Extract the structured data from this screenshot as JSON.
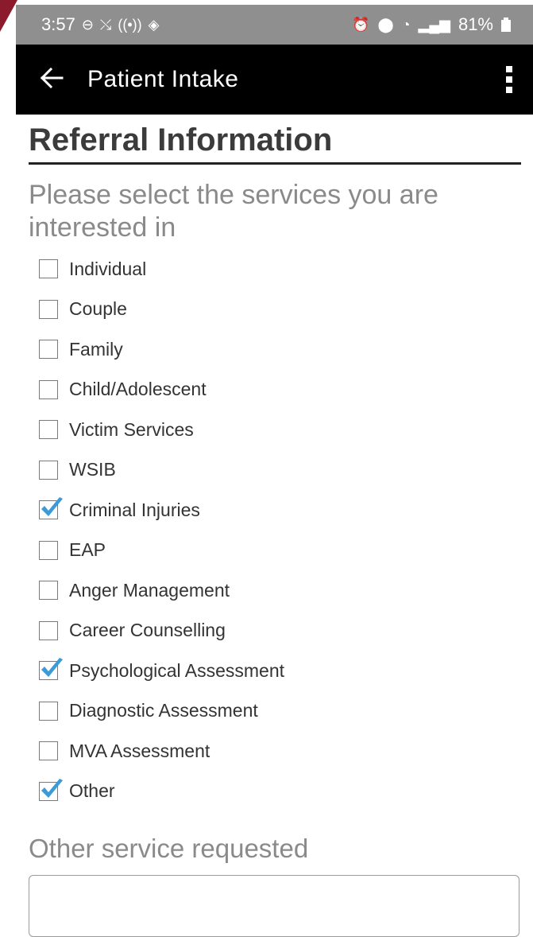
{
  "status_bar": {
    "time": "3:57",
    "left_icons": [
      "do-not-disturb-icon",
      "missed-call-icon",
      "hotspot-icon",
      "navigation-icon"
    ],
    "right_icons": [
      "alarm-icon",
      "location-icon",
      "wifi-icon",
      "signal-icon"
    ],
    "battery": "81%"
  },
  "app_bar": {
    "title": "Patient Intake",
    "back_icon": "arrow-left-icon",
    "menu_icon": "more-vertical-icon"
  },
  "form": {
    "section_title": "Referral Information",
    "question": "Please select the services you are interested in",
    "options": [
      {
        "label": "Individual",
        "checked": false
      },
      {
        "label": "Couple",
        "checked": false
      },
      {
        "label": "Family",
        "checked": false
      },
      {
        "label": "Child/Adolescent",
        "checked": false
      },
      {
        "label": "Victim Services",
        "checked": false
      },
      {
        "label": "WSIB",
        "checked": false
      },
      {
        "label": "Criminal Injuries",
        "checked": true
      },
      {
        "label": "EAP",
        "checked": false
      },
      {
        "label": "Anger Management",
        "checked": false
      },
      {
        "label": "Career Counselling",
        "checked": false
      },
      {
        "label": "Psychological Assessment",
        "checked": true
      },
      {
        "label": "Diagnostic Assessment",
        "checked": false
      },
      {
        "label": "MVA Assessment",
        "checked": false
      },
      {
        "label": "Other",
        "checked": true
      }
    ],
    "other_label": "Other service requested",
    "other_value": ""
  },
  "colors": {
    "status_bar_bg": "#8f8f8f",
    "app_bar_bg": "#000000",
    "check_mark": "#3a9bd8",
    "accent_corner": "#8b1a2c"
  }
}
